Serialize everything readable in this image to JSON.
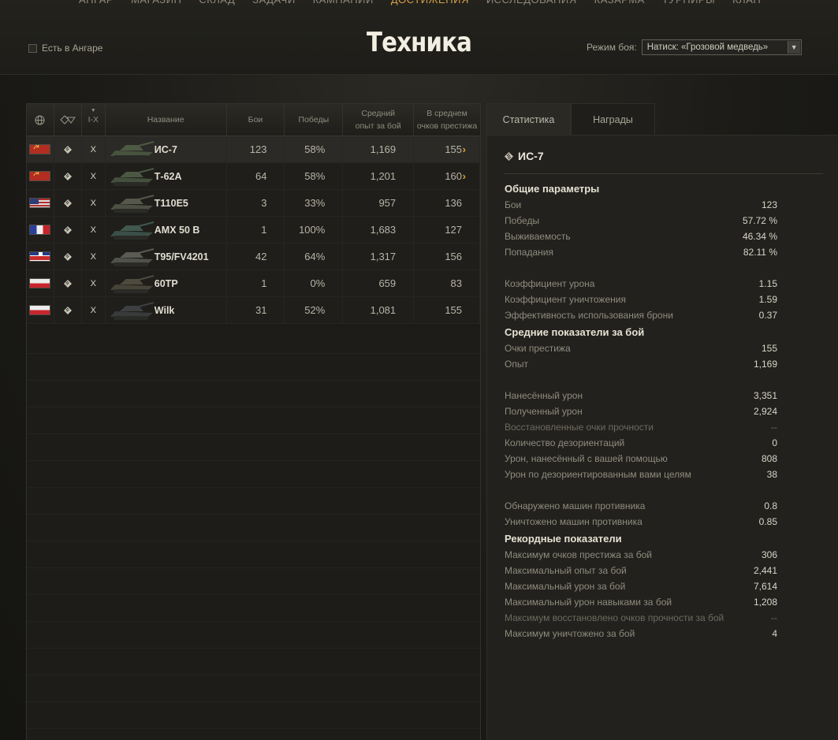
{
  "top_nav": [
    "АНГАР",
    "МАГАЗИН",
    "СКЛАД",
    "ЗАДАЧИ",
    "КАМПАНИИ",
    "ДОСТИЖЕНИЯ",
    "ИССЛЕДОВАНИЯ",
    "КАЗАРМА",
    "ТУРНИРЫ",
    "КЛАН"
  ],
  "top_nav_active": 5,
  "header": {
    "in_hangar_label": "Есть в Ангаре",
    "title": "Техника",
    "mode_label": "Режим боя:",
    "mode_value": "Натиск: «Грозовой медведь»"
  },
  "table": {
    "headers": {
      "nation_icon": "globe-icon",
      "class_icon": "vehicle-class-icon",
      "tier": "I-X",
      "name": "Название",
      "battles": "Бои",
      "wins": "Победы",
      "avg_xp": "Средний опыт за бой",
      "avg_prestige": "В среднем очков престижа"
    },
    "rows": [
      {
        "nation": "ussr",
        "tier": "X",
        "name": "ИС-7",
        "battles": "123",
        "wins": "58%",
        "xp": "1,169",
        "prestige": "155",
        "arrow": true
      },
      {
        "nation": "ussr",
        "tier": "X",
        "name": "Т-62А",
        "battles": "64",
        "wins": "58%",
        "xp": "1,201",
        "prestige": "160",
        "arrow": true
      },
      {
        "nation": "usa",
        "tier": "X",
        "name": "T110E5",
        "battles": "3",
        "wins": "33%",
        "xp": "957",
        "prestige": "136",
        "arrow": false
      },
      {
        "nation": "france",
        "tier": "X",
        "name": "AMX 50 B",
        "battles": "1",
        "wins": "100%",
        "xp": "1,683",
        "prestige": "127",
        "arrow": false
      },
      {
        "nation": "uk",
        "tier": "X",
        "name": "T95/FV4201",
        "battles": "42",
        "wins": "64%",
        "xp": "1,317",
        "prestige": "156",
        "arrow": false
      },
      {
        "nation": "poland",
        "tier": "X",
        "name": "60TP",
        "battles": "1",
        "wins": "0%",
        "xp": "659",
        "prestige": "83",
        "arrow": false
      },
      {
        "nation": "poland",
        "tier": "X",
        "name": "Wilk",
        "battles": "31",
        "wins": "52%",
        "xp": "1,081",
        "prestige": "155",
        "arrow": false
      }
    ]
  },
  "tabs": {
    "statistics": "Статистика",
    "awards": "Награды"
  },
  "panel": {
    "vehicle_name": "ИС-7",
    "general_title": "Общие параметры",
    "general": [
      {
        "label": "Бои",
        "value": "123"
      },
      {
        "label": "Победы",
        "value": "57.72 %"
      },
      {
        "label": "Выживаемость",
        "value": "46.34 %"
      },
      {
        "label": "Попадания",
        "value": "82.11 %"
      }
    ],
    "coeffs": [
      {
        "label": "Коэффициент урона",
        "value": "1.15"
      },
      {
        "label": "Коэффициент уничтожения",
        "value": "1.59"
      },
      {
        "label": "Эффективность использования брони",
        "value": "0.37"
      }
    ],
    "avg_title": "Средние показатели за бой",
    "avg1": [
      {
        "label": "Очки престижа",
        "value": "155"
      },
      {
        "label": "Опыт",
        "value": "1,169"
      }
    ],
    "avg2": [
      {
        "label": "Нанесённый урон",
        "value": "3,351"
      },
      {
        "label": "Полученный урон",
        "value": "2,924"
      },
      {
        "label": "Восстановленные очки прочности",
        "value": "--"
      },
      {
        "label": "Количество дезориентаций",
        "value": "0"
      },
      {
        "label": "Урон, нанесённый с вашей помощью",
        "value": "808"
      },
      {
        "label": "Урон по дезориентированным вами целям",
        "value": "38"
      }
    ],
    "avg3": [
      {
        "label": "Обнаружено машин противника",
        "value": "0.8"
      },
      {
        "label": "Уничтожено машин противника",
        "value": "0.85"
      }
    ],
    "record_title": "Рекордные показатели",
    "records": [
      {
        "label": "Максимум очков престижа за бой",
        "value": "306"
      },
      {
        "label": "Максимальный опыт за бой",
        "value": "2,441"
      },
      {
        "label": "Максимальный урон за бой",
        "value": "7,614"
      },
      {
        "label": "Максимальный урон навыками за бой",
        "value": "1,208"
      },
      {
        "label": "Максимум восстановлено очков прочности за бой",
        "value": "--"
      },
      {
        "label": "Максимум уничтожено за бой",
        "value": "4"
      }
    ]
  }
}
